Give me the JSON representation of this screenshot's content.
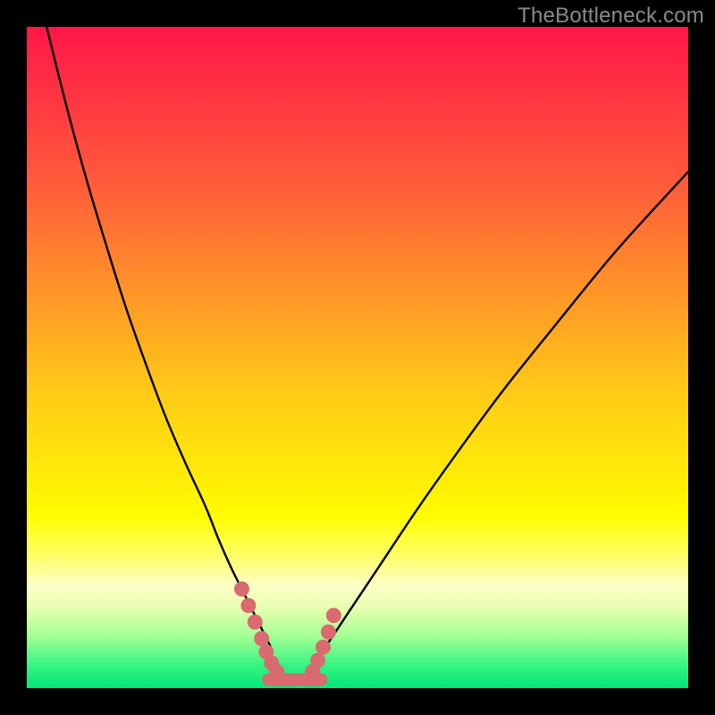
{
  "watermark": "TheBottleneck.com",
  "chart_data": {
    "type": "line",
    "title": "",
    "xlabel": "",
    "ylabel": "",
    "xlim": [
      0,
      100
    ],
    "ylim": [
      0,
      100
    ],
    "grid": false,
    "legend": false,
    "gradient_stops": [
      {
        "offset": 0.0,
        "color": "#ff1648"
      },
      {
        "offset": 0.235,
        "color": "#ff5b3a"
      },
      {
        "offset": 0.55,
        "color": "#ffc917"
      },
      {
        "offset": 0.74,
        "color": "#fffc00"
      },
      {
        "offset": 0.8,
        "color": "#fdff68"
      },
      {
        "offset": 0.845,
        "color": "#fdffc7"
      },
      {
        "offset": 0.877,
        "color": "#e9ffb1"
      },
      {
        "offset": 0.92,
        "color": "#a6ff94"
      },
      {
        "offset": 0.965,
        "color": "#38f483"
      },
      {
        "offset": 1.0,
        "color": "#00e677"
      }
    ],
    "series": [
      {
        "name": "left-curve",
        "stroke": "#000000",
        "x": [
          3,
          6,
          9,
          12,
          15,
          18,
          21,
          24,
          27,
          29,
          31,
          33,
          34.5,
          36,
          37
        ],
        "y": [
          100,
          88,
          77,
          67,
          57.5,
          49,
          41,
          34,
          27.5,
          22.5,
          18,
          14,
          11,
          8,
          6
        ]
      },
      {
        "name": "right-curve",
        "stroke": "#000000",
        "x": [
          45,
          47,
          50,
          54,
          59,
          65,
          72,
          80,
          89,
          99,
          100
        ],
        "y": [
          6,
          9,
          13.5,
          19.5,
          27,
          35.5,
          45,
          55,
          66,
          77,
          78
        ]
      },
      {
        "name": "left-markers",
        "type": "scatter",
        "color": "#d96a6f",
        "x": [
          32.5,
          33.5,
          34.5,
          35.5,
          36.2,
          37.0,
          37.8
        ],
        "y": [
          15.0,
          12.5,
          10.0,
          7.5,
          5.5,
          3.8,
          2.5
        ]
      },
      {
        "name": "right-markers",
        "type": "scatter",
        "color": "#d96a6f",
        "x": [
          43.2,
          44.0,
          44.8,
          45.6,
          46.4
        ],
        "y": [
          2.5,
          4.2,
          6.2,
          8.5,
          11.0
        ]
      },
      {
        "name": "valley-floor",
        "type": "line",
        "stroke": "#d96a6f",
        "stroke_width": 14,
        "x": [
          36.5,
          44.5
        ],
        "y": [
          1.3,
          1.3
        ]
      }
    ]
  }
}
